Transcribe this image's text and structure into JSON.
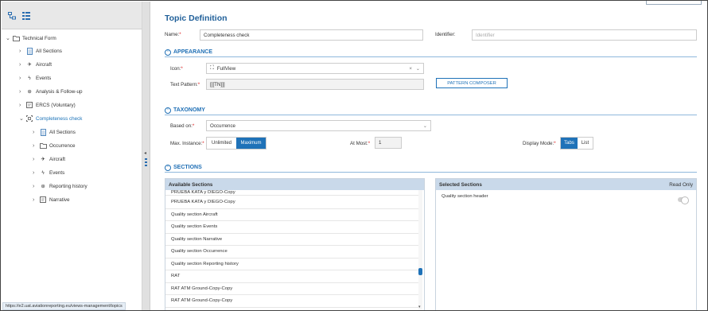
{
  "sidebar": {
    "tree": [
      {
        "label": "Technical Form",
        "icon": "folder-icon"
      },
      {
        "label": "All Sections",
        "icon": "list-icon"
      },
      {
        "label": "Aircraft",
        "icon": "airplane-icon"
      },
      {
        "label": "Events",
        "icon": "lightning-icon"
      },
      {
        "label": "Analysis & Follow-up",
        "icon": "target-icon"
      },
      {
        "label": "ERCS (Voluntary)",
        "icon": "form-icon"
      },
      {
        "label": "Completeness check",
        "icon": "topic-icon"
      },
      {
        "label": "All Sections",
        "icon": "list-icon"
      },
      {
        "label": "Occurrence",
        "icon": "folder-icon"
      },
      {
        "label": "Aircraft",
        "icon": "airplane-icon"
      },
      {
        "label": "Events",
        "icon": "lightning-icon"
      },
      {
        "label": "Reporting history",
        "icon": "target-icon"
      },
      {
        "label": "Narrative",
        "icon": "form-icon"
      }
    ],
    "status_url": "https://e2.uat.aviationreporting.eu/views-management/topics"
  },
  "main": {
    "title": "Topic Definition",
    "name_label": "Name:",
    "name_value": "Completeness check",
    "identifier_label": "Identifier:",
    "identifier_placeholder": "Identifier",
    "appearance": {
      "header": "APPEARANCE",
      "icon_label": "Icon:",
      "icon_value": "FullView",
      "text_pattern_label": "Text Pattern:",
      "text_pattern_value": "[[[TN]]]",
      "pattern_button": "PATTERN COMPOSER"
    },
    "taxonomy": {
      "header": "TAXONOMY",
      "based_on_label": "Based on:",
      "based_on_value": "Occurrence",
      "max_instance_label": "Max. Instance:",
      "max_options": [
        "Unlimited",
        "Maximum"
      ],
      "max_selected": "Maximum",
      "at_most_label": "At Most:",
      "at_most_value": "1",
      "display_mode_label": "Display Mode:",
      "display_options": [
        "Tabs",
        "List"
      ],
      "display_selected": "Tabs"
    },
    "sections": {
      "header": "SECTIONS",
      "available_header": "Available Sections",
      "available_items": [
        "PRUEBA KATA y DIEGO-Copy",
        "Quality section Aircraft",
        "Quality section Events",
        "Quality section Narrative",
        "Quality section Occurrence",
        "Quality section Reporting history",
        "RAT",
        "RAT ATM Ground-Copy-Copy",
        "RAT ATM Ground-Copy-Copy"
      ],
      "selected_header": "Selected Sections",
      "read_only_label": "Read Only",
      "selected_items": [
        {
          "label": "Quality section header",
          "read_only": false
        }
      ]
    }
  }
}
